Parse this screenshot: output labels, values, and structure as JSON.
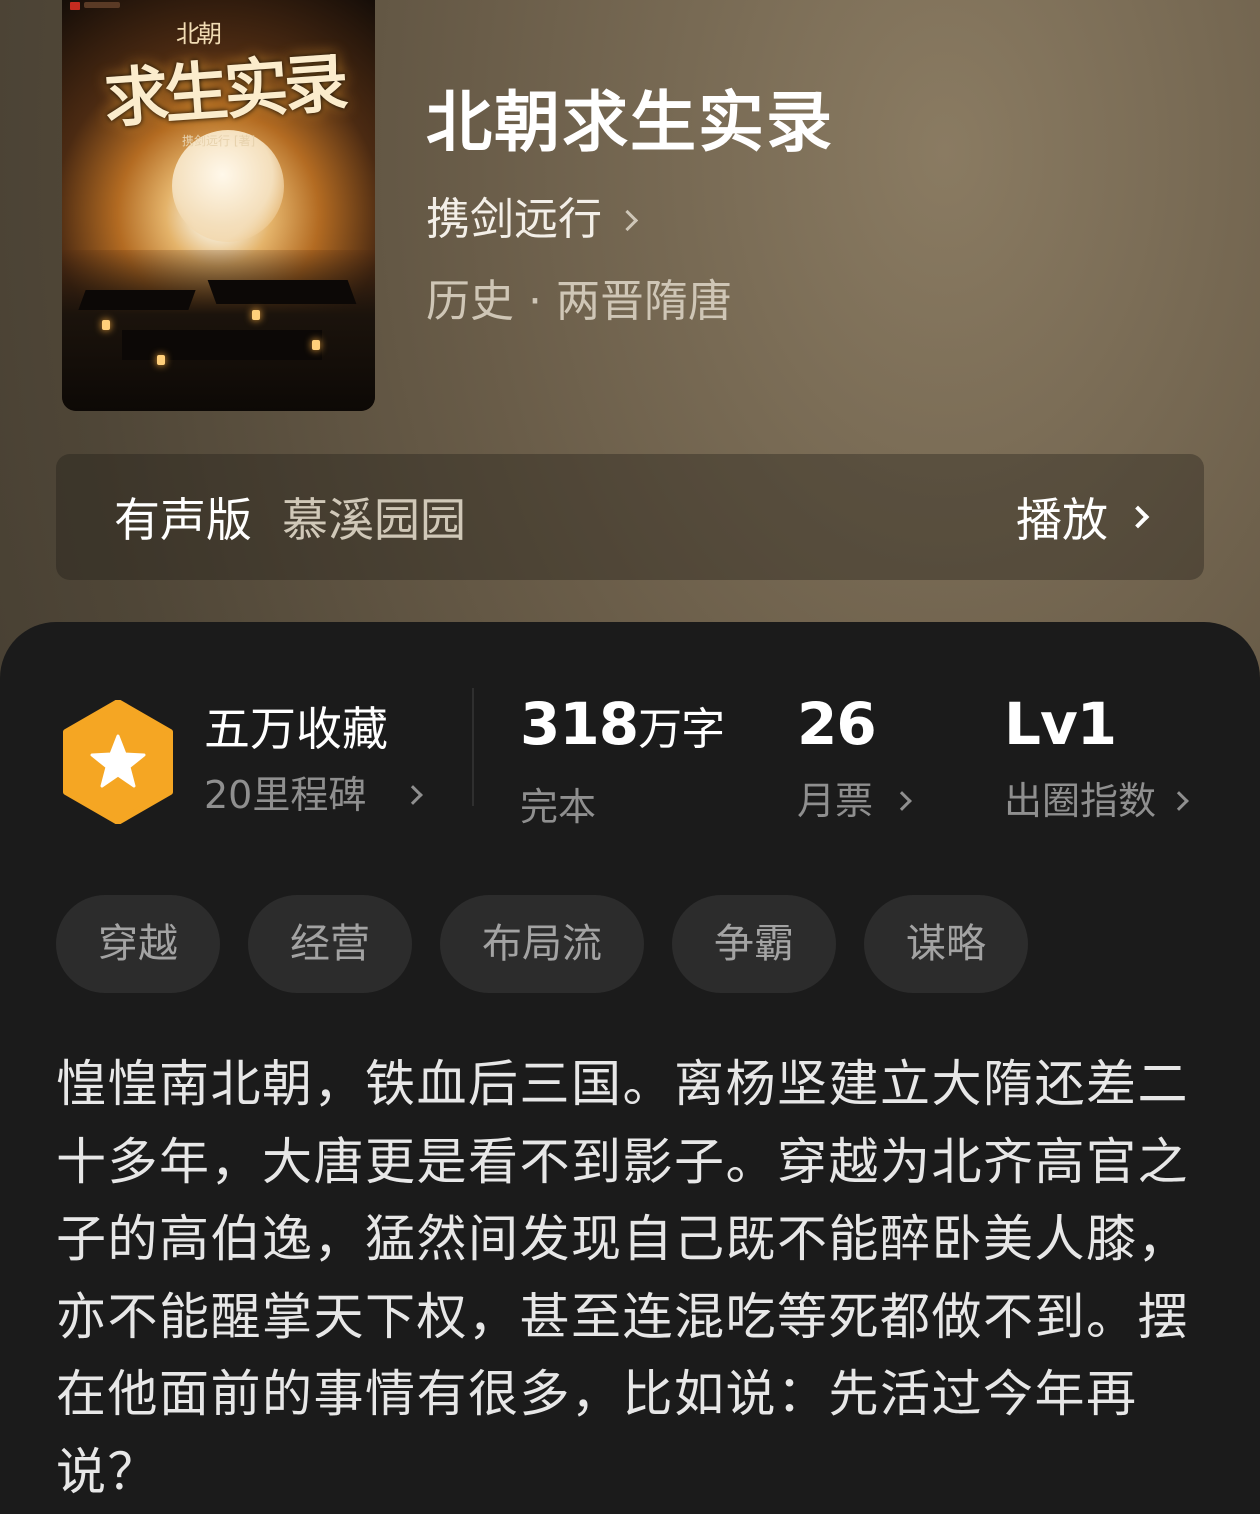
{
  "cover": {
    "prefix": "北朝",
    "title_art": "求生实录",
    "small_author": "携剑远行 [著]"
  },
  "book": {
    "title": "北朝求生实录",
    "author": "携剑远行",
    "category": "历史 · 两晋隋唐"
  },
  "audio": {
    "label": "有声版",
    "narrator": "慕溪园园",
    "play_label": "播放"
  },
  "stats": {
    "collection_title": "五万收藏",
    "collection_sub": "20里程碑",
    "words_number": "318",
    "words_unit": "万字",
    "words_status": "完本",
    "monthly_votes": "26",
    "monthly_votes_label": "月票",
    "level": "Lv1",
    "level_label": "出圈指数"
  },
  "tags": [
    "穿越",
    "经营",
    "布局流",
    "争霸",
    "谋略"
  ],
  "synopsis": "惶惶南北朝，铁血后三国。离杨坚建立大隋还差二十多年，大唐更是看不到影子。穿越为北齐高官之子的高伯逸，猛然间发现自己既不能醉卧美人膝，亦不能醒掌天下权，甚至连混吃等死都做不到。摆在他面前的事情有很多，比如说：先活过今年再说？",
  "colors": {
    "badge_orange": "#f5a623",
    "panel_bg": "#1b1b1b",
    "tag_bg": "#2c2c2c"
  }
}
